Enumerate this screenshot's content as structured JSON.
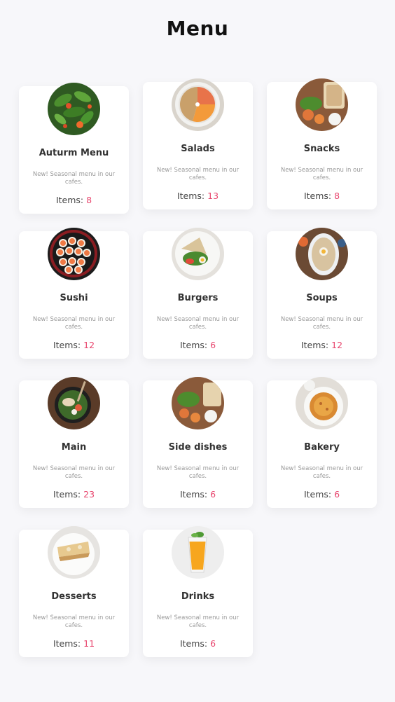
{
  "page": {
    "title": "Menu"
  },
  "cards": [
    {
      "title": "Auturm Menu",
      "description": "New! Seasonal menu in our cafes.",
      "items_label": "Items:",
      "count": "8",
      "image": "green-salad-image"
    },
    {
      "title": "Salads",
      "description": "New! Seasonal menu in our cafes.",
      "items_label": "Items:",
      "count": "13",
      "image": "salad-plate-image"
    },
    {
      "title": "Snacks",
      "description": "New! Seasonal menu in our cafes.",
      "items_label": "Items:",
      "count": "8",
      "image": "snack-board-image"
    },
    {
      "title": "Sushi",
      "description": "New! Seasonal menu in our cafes.",
      "items_label": "Items:",
      "count": "12",
      "image": "sushi-platter-image"
    },
    {
      "title": "Burgers",
      "description": "New! Seasonal menu in our cafes.",
      "items_label": "Items:",
      "count": "6",
      "image": "burger-plate-image"
    },
    {
      "title": "Soups",
      "description": "New! Seasonal menu in our cafes.",
      "items_label": "Items:",
      "count": "12",
      "image": "soup-bowl-image"
    },
    {
      "title": "Main",
      "description": "New! Seasonal menu in our cafes.",
      "items_label": "Items:",
      "count": "23",
      "image": "main-bowl-image"
    },
    {
      "title": "Side dishes",
      "description": "New! Seasonal menu in our cafes.",
      "items_label": "Items:",
      "count": "6",
      "image": "side-board-image"
    },
    {
      "title": "Bakery",
      "description": "New! Seasonal menu in our cafes.",
      "items_label": "Items:",
      "count": "6",
      "image": "bakery-plate-image"
    },
    {
      "title": "Desserts",
      "description": "New! Seasonal menu in our cafes.",
      "items_label": "Items:",
      "count": "11",
      "image": "dessert-plate-image"
    },
    {
      "title": "Drinks",
      "description": "New! Seasonal menu in our cafes.",
      "items_label": "Items:",
      "count": "6",
      "image": "juice-glass-image"
    }
  ],
  "colors": {
    "accent": "#e8466e",
    "background": "#f7f7fa",
    "card": "#ffffff"
  }
}
